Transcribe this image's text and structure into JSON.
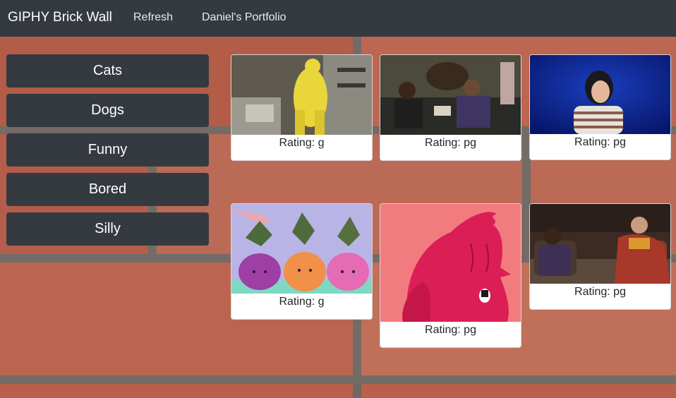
{
  "navbar": {
    "brand": "GIPHY Brick Wall",
    "links": [
      "Refresh",
      "Daniel's Portfolio"
    ]
  },
  "topics": [
    "Cats",
    "Dogs",
    "Funny",
    "Bored",
    "Silly"
  ],
  "gifs": [
    {
      "rating": "Rating: g",
      "subject": "person in yellow suit in kitchen"
    },
    {
      "rating": "Rating: pg",
      "subject": "two hosts laughing on couch with bison"
    },
    {
      "rating": "Rating: pg",
      "subject": "woman laughing on blue background"
    },
    {
      "rating": "Rating: g",
      "subject": "illustrated vegetables being watered"
    },
    {
      "rating": "Rating: pg",
      "subject": "pink cartoon character laughing"
    },
    {
      "rating": "Rating: pg",
      "subject": "two elders laughing in chairs"
    }
  ],
  "colors": {
    "navbar": "#343a40",
    "brick": "#b8604a",
    "mortar": "#736b66",
    "card": "#ffffff"
  }
}
